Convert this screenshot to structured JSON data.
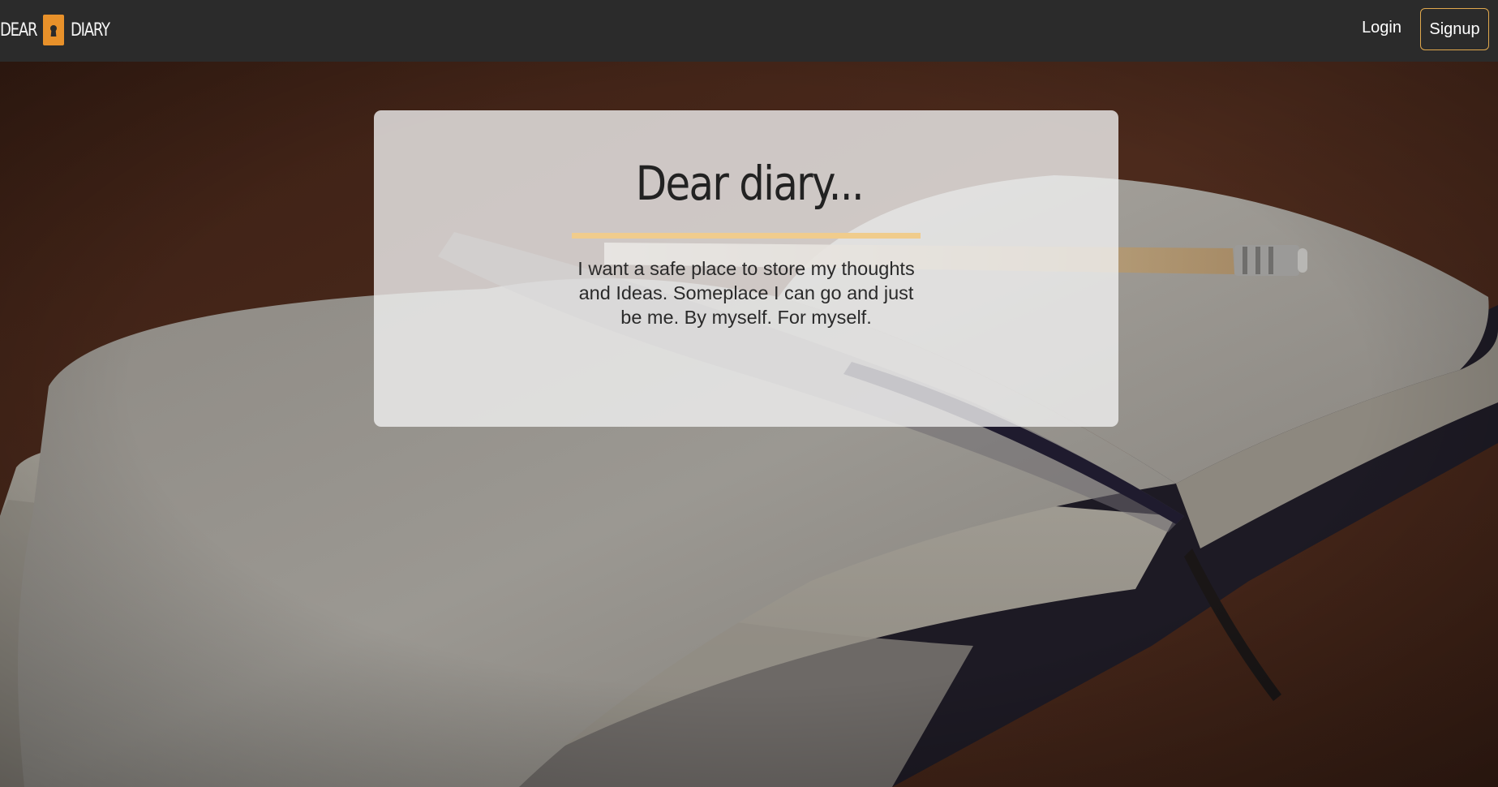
{
  "navbar": {
    "brand_left": "DEAR",
    "brand_right": "DIARY",
    "brand_icon": "keyhole-icon",
    "login_label": "Login",
    "signup_label": "Signup"
  },
  "hero": {
    "title": "Dear diary...",
    "text": "I want a safe place to store my thoughts and Ideas. Someplace I can go and just be me. By myself. For myself."
  },
  "colors": {
    "navbar": "#2b2b2b",
    "accent": "#e8912a",
    "signup_border": "#e0a84d",
    "title_rule": "#f0cc8c"
  }
}
